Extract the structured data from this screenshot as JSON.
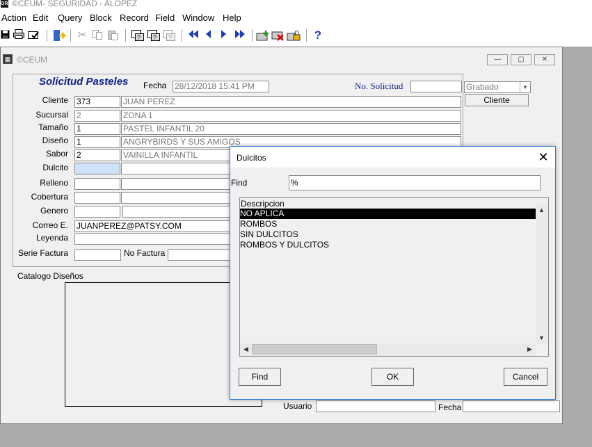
{
  "app": {
    "title": "©CEUM- SEGURIDAD - ALOPEZ",
    "logo_text": "ORA"
  },
  "menu": [
    "Action",
    "Edit",
    "Query",
    "Block",
    "Record",
    "Field",
    "Window",
    "Help"
  ],
  "toolbar": {
    "icons": [
      "save-icon",
      "print-icon",
      "print-preview-icon",
      "exit-icon",
      "cut-icon",
      "copy-icon",
      "paste-icon",
      "enter-query-icon",
      "execute-query-icon",
      "cancel-query-icon",
      "first-record-icon",
      "previous-record-icon",
      "next-record-icon",
      "last-record-icon",
      "insert-record-icon",
      "delete-record-icon",
      "lock-record-icon",
      "help-icon"
    ],
    "help_glyph": "?"
  },
  "window": {
    "title": "©CEUM",
    "min": "—",
    "max": "▢",
    "close": "✕"
  },
  "form": {
    "title": "Solicitud Pasteles",
    "fecha_label": "Fecha",
    "fecha_value": "28/12/2018 15:41 PM",
    "no_solicitud_label": "No. Solicitud",
    "no_solicitud_value": "",
    "status_value": "Grabado",
    "cliente_button": "Cliente",
    "fields": [
      {
        "label": "Cliente",
        "code": "373",
        "desc": "JUAN PEREZ"
      },
      {
        "label": "Sucursal",
        "code": "2",
        "desc": "ZONA 1"
      },
      {
        "label": "Tamaño",
        "code": "1",
        "desc": "PASTEL INFANTIL 20"
      },
      {
        "label": "Diseño",
        "code": "1",
        "desc": "ANGRYBIRDS Y SUS AMIGOS"
      },
      {
        "label": "Sabor",
        "code": "2",
        "desc": "VAINILLA INFANTIL"
      },
      {
        "label": "Dulcito",
        "code": "",
        "desc": ""
      },
      {
        "label": "Relleno",
        "code": "",
        "desc": ""
      },
      {
        "label": "Cobertura",
        "code": "",
        "desc": ""
      },
      {
        "label": "Genero",
        "code": "",
        "desc": ""
      }
    ],
    "correo_label": "Correo E.",
    "correo_value": "JUANPEREZ@PATSY.COM",
    "leyenda_label": "Leyenda",
    "leyenda_value": "",
    "serie_label": "Serie Factura",
    "serie_value": "",
    "no_factura_label": "No Factura",
    "no_factura_value": "",
    "catalogo_label": "Catalogo Diseños",
    "usuario_label": "Usuario",
    "usuario_value": "",
    "fecha2_label": "Fecha",
    "fecha2_value": ""
  },
  "dialog": {
    "title": "Dulcitos",
    "find_label": "Find",
    "find_value": "%",
    "column_header": "Descripcion",
    "items": [
      "NO APLICA",
      "ROMBOS",
      "SIN DULCITOS",
      "ROMBOS Y DULCITOS"
    ],
    "selected_index": 0,
    "buttons": {
      "find": "Find",
      "ok": "OK",
      "cancel": "Cancel"
    }
  }
}
